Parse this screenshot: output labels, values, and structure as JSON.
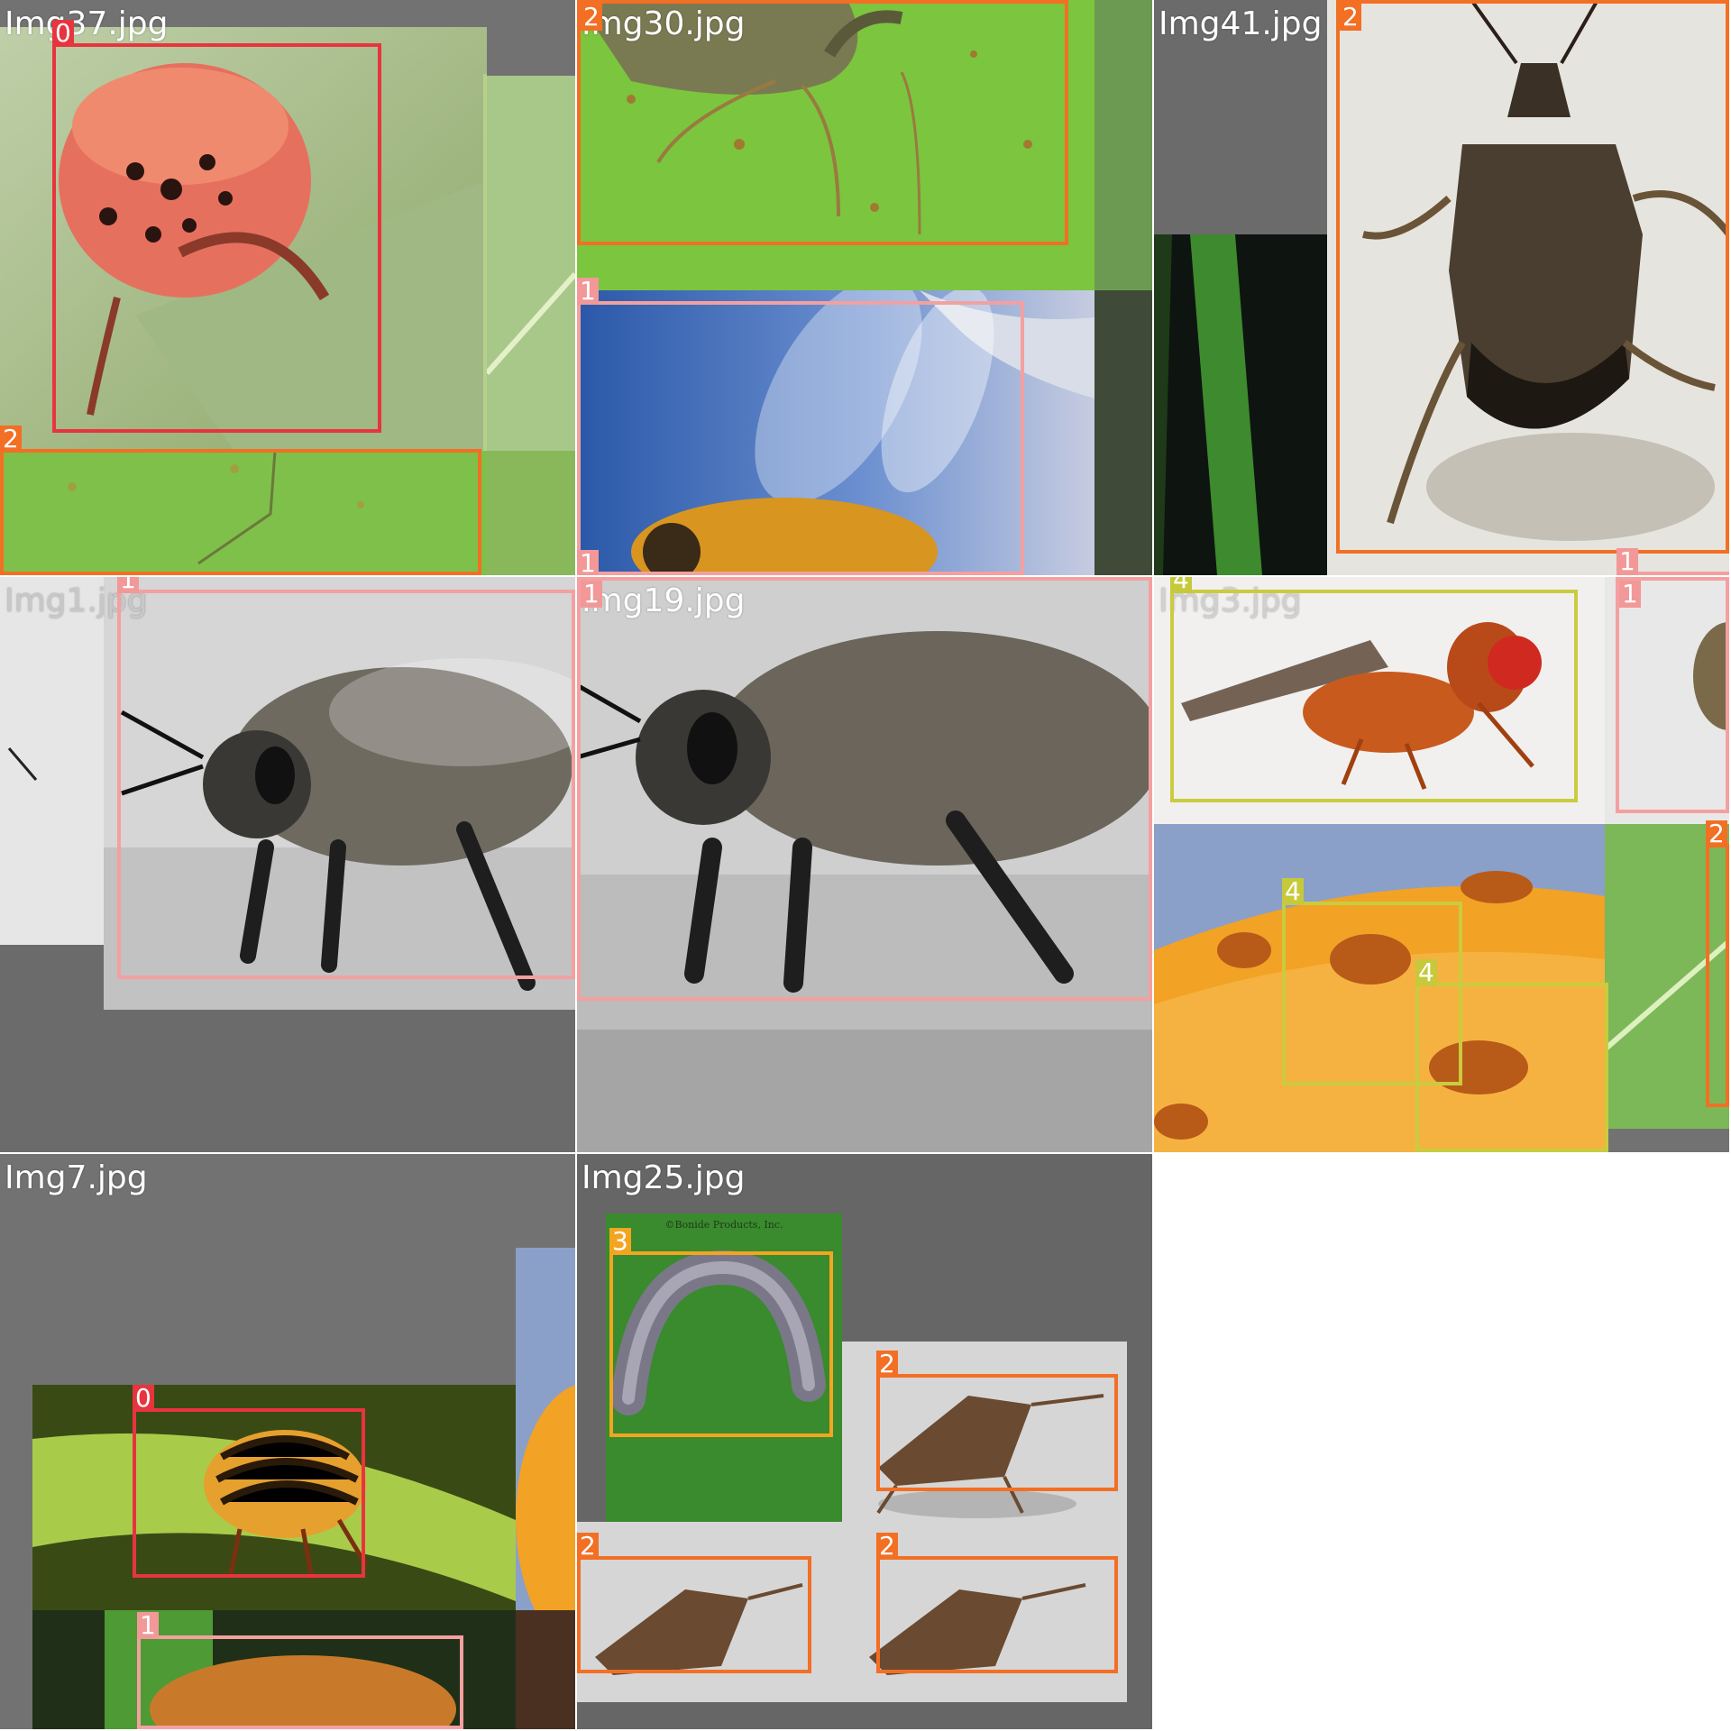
{
  "tiles": [
    {
      "filename": "Img37.jpg"
    },
    {
      "filename": "Img30.jpg"
    },
    {
      "filename": "Img41.jpg"
    },
    {
      "filename": "Img1.jpg"
    },
    {
      "filename": "Img19.jpg"
    },
    {
      "filename": "Img3.jpg"
    },
    {
      "filename": "Img7.jpg"
    },
    {
      "filename": "Img25.jpg"
    }
  ],
  "labels": {
    "l0": "0",
    "l1": "1",
    "l2": "2",
    "l3": "3",
    "l4": "4"
  },
  "watermark": "©Bonide Products, Inc.",
  "colors": {
    "class_0": "#e8343f",
    "class_1": "#f4a0a0",
    "class_2": "#f26f24",
    "class_3": "#f3a521",
    "class_4": "#c9cc3e",
    "tile_background": "#727272"
  }
}
